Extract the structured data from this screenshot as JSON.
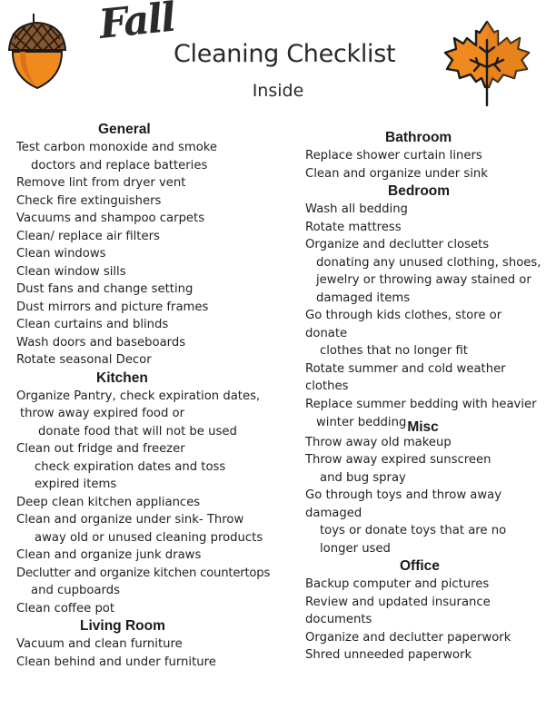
{
  "header": {
    "title_script": "Fall",
    "title_main": "Cleaning Checklist",
    "subtitle": "Inside",
    "icons": [
      "acorn-icon",
      "maple-leaf-icon"
    ],
    "colors": {
      "orange": "#F0891E",
      "brown": "#7A4A22",
      "outline": "#1a1a1a"
    }
  },
  "sections": {
    "general": {
      "title": "General",
      "items": [
        "Test carbon monoxide and smoke",
        "doctors and replace batteries",
        "Remove lint from dryer vent",
        "Check fire extinguishers",
        "Vacuums and shampoo carpets",
        "Clean/ replace air filters",
        "Clean windows",
        "Clean window sills",
        "Dust fans and change setting",
        "Dust mirrors and picture frames",
        "Clean curtains and blinds",
        "Wash doors and baseboards",
        "Rotate seasonal Decor"
      ]
    },
    "kitchen": {
      "title": "Kitchen",
      "items": [
        "Organize Pantry, check expiration dates,",
        "throw away expired food or",
        "donate food that will not be used",
        "Clean out fridge and freezer",
        "check expiration dates and toss",
        "expired items",
        "Deep clean kitchen appliances",
        "Clean and organize under sink- Throw",
        "away old or unused cleaning products",
        "Clean and organize junk draws",
        "Declutter and organize kitchen countertops",
        "and cupboards",
        "Clean coffee pot"
      ]
    },
    "living_room": {
      "title": "Living Room",
      "items": [
        "Vacuum and clean furniture",
        "Clean behind and under furniture"
      ]
    },
    "bathroom": {
      "title": "Bathroom",
      "items": [
        "Replace shower curtain liners",
        "Clean and organize under sink"
      ]
    },
    "bedroom": {
      "title": "Bedroom",
      "items": [
        "Wash all bedding",
        "Rotate mattress",
        "Organize and declutter closets",
        "donating any unused clothing, shoes,",
        "jewelry or throwing away stained or",
        "damaged items",
        "Go through kids clothes, store or",
        "donate",
        "clothes that no longer fit",
        "Rotate summer and cold weather",
        "clothes",
        "Replace summer bedding with heavier",
        "winter bedding"
      ]
    },
    "misc": {
      "title": "Misc",
      "items": [
        "Throw away old makeup",
        "Throw away expired sunscreen",
        "and bug spray",
        "Go through toys and throw away",
        "damaged",
        "toys or donate toys that are no",
        "longer used"
      ]
    },
    "office": {
      "title": "Office",
      "items": [
        "Backup computer and pictures",
        "Review and updated insurance",
        "documents",
        "Organize and declutter paperwork",
        "Shred unneeded paperwork"
      ]
    }
  }
}
